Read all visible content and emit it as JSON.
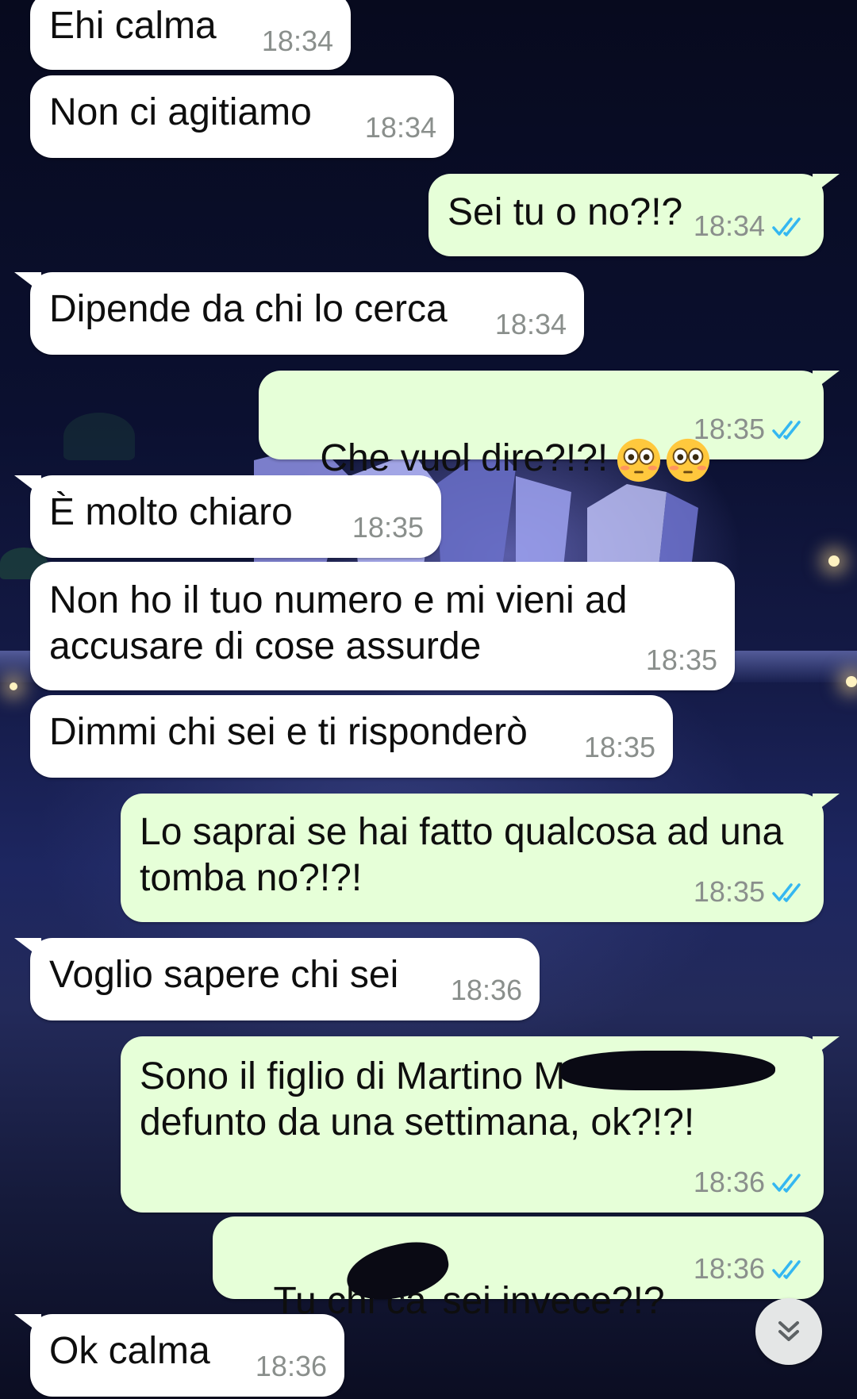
{
  "colors": {
    "incoming_bubble": "#ffffff",
    "outgoing_bubble": "#e6ffd8",
    "timestamp": "#8a8f8c",
    "read_ticks": "#34b7f1"
  },
  "messages": [
    {
      "direction": "in",
      "text": "Ehi calma",
      "time": "18:34"
    },
    {
      "direction": "in",
      "text": "Non ci agitiamo",
      "time": "18:34"
    },
    {
      "direction": "out",
      "text": "Sei tu o no?!?",
      "time": "18:34",
      "status": "read"
    },
    {
      "direction": "in",
      "text": "Dipende da chi lo cerca",
      "time": "18:34"
    },
    {
      "direction": "out",
      "text": "Che vuol dire?!?!",
      "time": "18:35",
      "status": "read",
      "emojis": [
        "flushed-face",
        "flushed-face"
      ]
    },
    {
      "direction": "in",
      "text": "È molto chiaro",
      "time": "18:35"
    },
    {
      "direction": "in",
      "text_line1": "Non ho il tuo numero e mi vieni ad",
      "text_line2": "accusare di cose assurde",
      "time": "18:35"
    },
    {
      "direction": "in",
      "text": "Dimmi chi sei e ti risponderò",
      "time": "18:35"
    },
    {
      "direction": "out",
      "text_line1": "Lo saprai se hai fatto qualcosa ad una",
      "text_line2": "tomba no?!?!",
      "time": "18:35",
      "status": "read"
    },
    {
      "direction": "in",
      "text": "Voglio sapere chi sei",
      "time": "18:36"
    },
    {
      "direction": "out",
      "text_line1": "Sono il figlio di Martino M",
      "text_line2": "defunto da una settimana, ok?!?!",
      "time": "18:36",
      "status": "read",
      "redacted": true
    },
    {
      "direction": "out",
      "text_part1": "Tu chi ca",
      "text_part2": "sei invece?!?",
      "time": "18:36",
      "status": "read",
      "redacted": true
    },
    {
      "direction": "in",
      "text": "Ok calma",
      "time": "18:36"
    }
  ],
  "scroll_button": {
    "icon": "double-chevron-down-icon"
  }
}
